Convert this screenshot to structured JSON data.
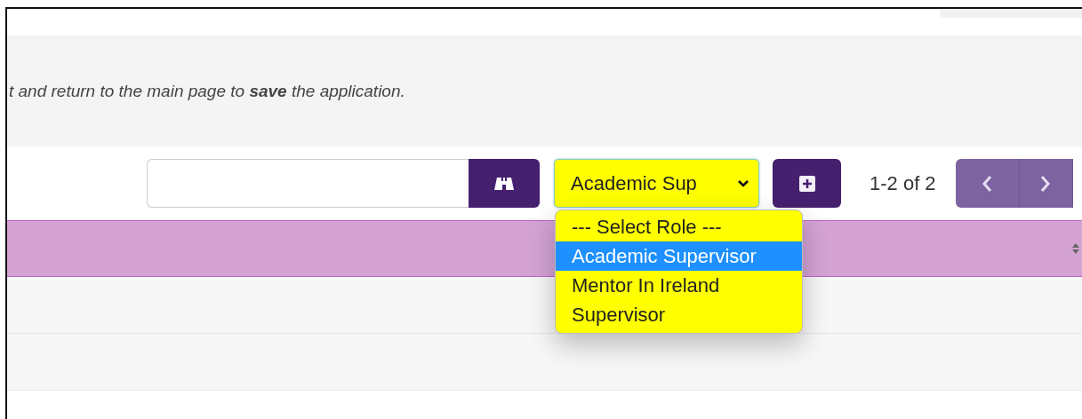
{
  "notice": "t and return to the main page to **save** the application.",
  "toolbar": {
    "role_select": {
      "value": "Academic Sup",
      "expanded": true
    },
    "range": "1-2 of 2"
  },
  "role_options": [
    {
      "label": "--- Select Role ---",
      "selected": false
    },
    {
      "label": "Academic Supervisor",
      "selected": true
    },
    {
      "label": "Mentor In Ireland",
      "selected": false
    },
    {
      "label": "Supervisor",
      "selected": false
    }
  ]
}
